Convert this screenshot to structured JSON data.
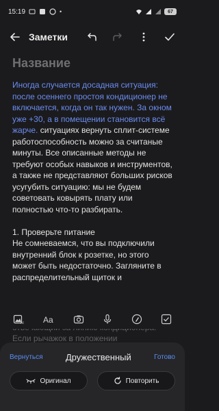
{
  "status": {
    "time": "15:19",
    "battery": "67"
  },
  "toolbar": {
    "title": "Заметки"
  },
  "note": {
    "title_placeholder": "Название",
    "highlighted": "Иногда случается досадная ситуация: после осеннего простоя кондиционер не включается, когда он так нужен. За окном уже +30, а в помещении становится всё жарче.",
    "para1_rest": " ситуациях вернуть сплит-системе работоспособность можно за считаные минуты. Все описанные методы не требуют особых навыков и инструментов, а также не представляют больших рисков усугубить ситуацию: мы не будем советовать ковырять плату или полностью что-то разбирать.",
    "heading": "1. Проверьте питание",
    "para2": "Не сомневаемся, что вы подключили внутренний блок к розетке, но этого может быть недостаточно. Загляните в распределительный щиток и",
    "peek": "отвечающий за линию кондиционера. Если рычажок в положении"
  },
  "ai_panel": {
    "back_label": "Вернуться",
    "style_label": "Дружественный",
    "done_label": "Готово",
    "original_label": "Оригинал",
    "repeat_label": "Повторить"
  }
}
